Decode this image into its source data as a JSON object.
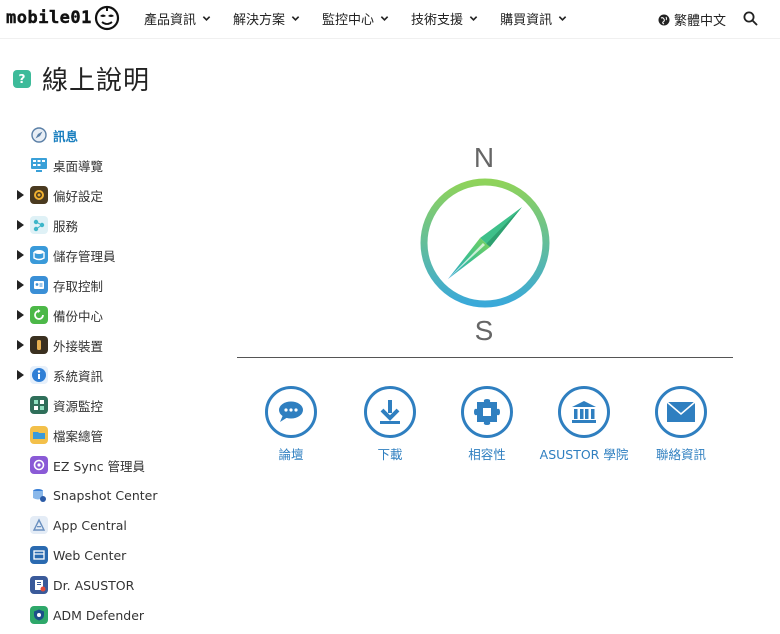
{
  "header": {
    "logo_text": "mobile01",
    "nav": [
      {
        "label": "產品資訊"
      },
      {
        "label": "解決方案"
      },
      {
        "label": "監控中心"
      },
      {
        "label": "技術支援"
      },
      {
        "label": "購買資訊"
      }
    ],
    "language": "繁體中文",
    "search_icon": "search-icon"
  },
  "page": {
    "title": "線上說明"
  },
  "sidebar": {
    "items": [
      {
        "label": "訊息",
        "icon": "compass-icon",
        "expandable": false,
        "active": true,
        "color": "#5a7fa6"
      },
      {
        "label": "桌面導覽",
        "icon": "desktop-icon",
        "expandable": false,
        "active": false,
        "color": "#3aa0d8"
      },
      {
        "label": "偏好設定",
        "icon": "gear-icon",
        "expandable": true,
        "active": false,
        "color": "#8a6a30"
      },
      {
        "label": "服務",
        "icon": "services-icon",
        "expandable": true,
        "active": false,
        "color": "#3db6c9"
      },
      {
        "label": "儲存管理員",
        "icon": "storage-icon",
        "expandable": true,
        "active": false,
        "color": "#3a9ad9"
      },
      {
        "label": "存取控制",
        "icon": "access-icon",
        "expandable": true,
        "active": false,
        "color": "#3a8fd6"
      },
      {
        "label": "備份中心",
        "icon": "backup-icon",
        "expandable": true,
        "active": false,
        "color": "#4cb848"
      },
      {
        "label": "外接裝置",
        "icon": "usb-icon",
        "expandable": true,
        "active": false,
        "color": "#6a5a3a"
      },
      {
        "label": "系統資訊",
        "icon": "info-icon",
        "expandable": true,
        "active": false,
        "color": "#2f7fd6"
      },
      {
        "label": "資源監控",
        "icon": "monitor-icon",
        "expandable": false,
        "active": false,
        "color": "#3a9a7a"
      },
      {
        "label": "檔案總管",
        "icon": "folder-icon",
        "expandable": false,
        "active": false,
        "color": "#e8a43a"
      },
      {
        "label": "EZ Sync 管理員",
        "icon": "ezsync-icon",
        "expandable": false,
        "active": false,
        "color": "#8a5ad6"
      },
      {
        "label": "Snapshot Center",
        "icon": "snapshot-icon",
        "expandable": false,
        "active": false,
        "color": "#3a7fd6"
      },
      {
        "label": "App Central",
        "icon": "app-central-icon",
        "expandable": false,
        "active": false,
        "color": "#8ab0d6"
      },
      {
        "label": "Web Center",
        "icon": "web-center-icon",
        "expandable": false,
        "active": false,
        "color": "#2a6ab0"
      },
      {
        "label": "Dr. ASUSTOR",
        "icon": "dr-asustor-icon",
        "expandable": false,
        "active": false,
        "color": "#3a5a9a"
      },
      {
        "label": "ADM Defender",
        "icon": "shield-icon",
        "expandable": false,
        "active": false,
        "color": "#2ea86a"
      }
    ]
  },
  "compass": {
    "north": "N",
    "south": "S",
    "ring_color_top": "#8fd35a",
    "ring_color_bottom": "#3aa9d9"
  },
  "links": [
    {
      "label": "論壇",
      "icon": "forum-icon"
    },
    {
      "label": "下載",
      "icon": "download-icon"
    },
    {
      "label": "相容性",
      "icon": "compatibility-icon"
    },
    {
      "label": "ASUSTOR 學院",
      "icon": "academy-icon"
    },
    {
      "label": "聯絡資訊",
      "icon": "mail-icon"
    }
  ],
  "colors": {
    "accent": "#2f7fc0",
    "active_sidebar": "#1a7fbf"
  }
}
